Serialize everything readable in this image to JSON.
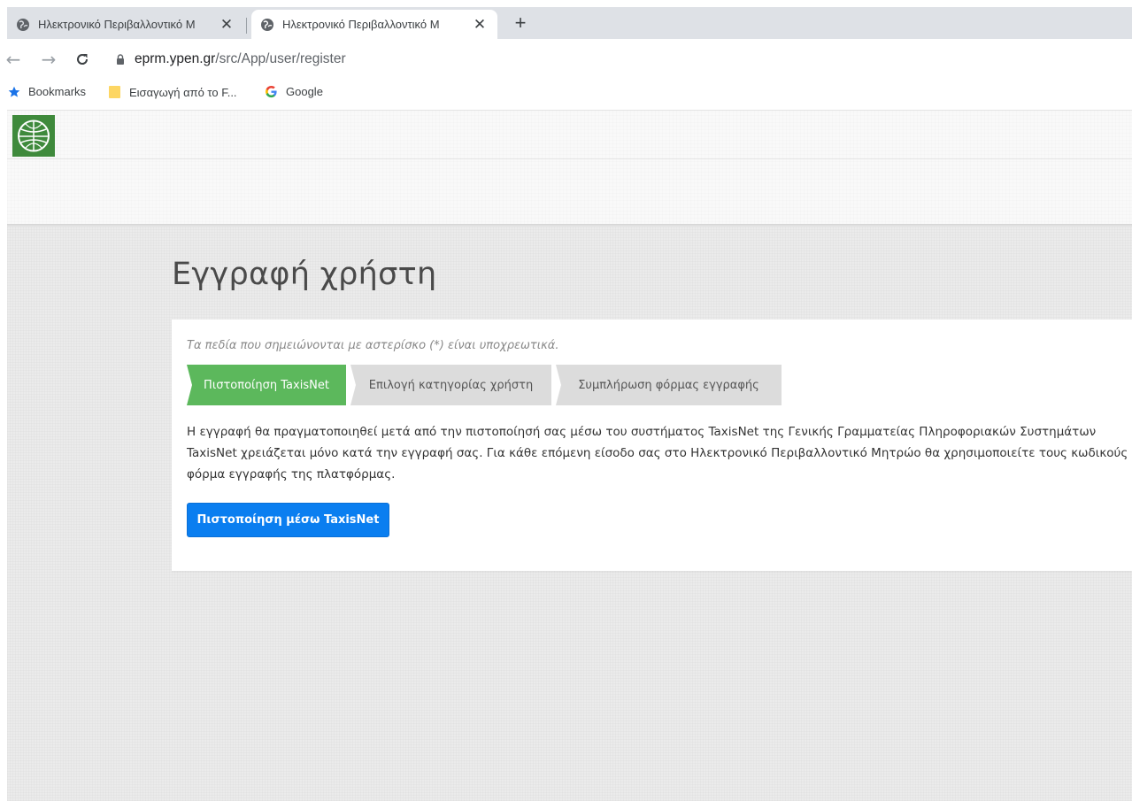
{
  "browser": {
    "tabs": [
      {
        "title": "Ηλεκτρονικό Περιβαλλοντικό Μ",
        "active": false
      },
      {
        "title": "Ηλεκτρονικό Περιβαλλοντικό Μ",
        "active": true
      }
    ],
    "close_glyph": "✕",
    "new_tab_glyph": "+",
    "url_host": "eprm.ypen.gr",
    "url_path": "/src/App/user/register",
    "bookmarks": [
      {
        "label": "Bookmarks",
        "icon": "star-icon"
      },
      {
        "label": "Εισαγωγή από το F...",
        "icon": "folder-icon"
      },
      {
        "label": "Google",
        "icon": "google-icon"
      }
    ]
  },
  "page": {
    "title": "Εγγραφή χρήστη",
    "required_note": "Τα πεδία που σημειώνονται με αστερίσκο (*) είναι υποχρεωτικά.",
    "steps": [
      {
        "label": "Πιστοποίηση TaxisNet",
        "active": true
      },
      {
        "label": "Επιλογή κατηγορίας χρήστη",
        "active": false
      },
      {
        "label": "Συμπλήρωση φόρμας εγγραφής",
        "active": false
      }
    ],
    "description_lines": [
      "Η εγγραφή θα πραγματοποιηθεί μετά από την πιστοποίησή σας μέσω του συστήματος TaxisNet της Γενικής Γραμματείας Πληροφοριακών Συστημάτων",
      "TaxisNet χρειάζεται μόνο κατά την εγγραφή σας. Για κάθε επόμενη είσοδο σας στο Ηλεκτρονικό Περιβαλλοντικό Μητρώο θα χρησιμοποιείτε τους κωδικούς",
      "φόρμα εγγραφής της πλατφόρμας."
    ],
    "button_label": "Πιστοποίηση μέσω TaxisNet"
  },
  "colors": {
    "step_active": "#5cb85c",
    "step_inactive": "#dcdcdc",
    "primary_button": "#0a7ef0",
    "logo_green": "#3f8a3c"
  }
}
